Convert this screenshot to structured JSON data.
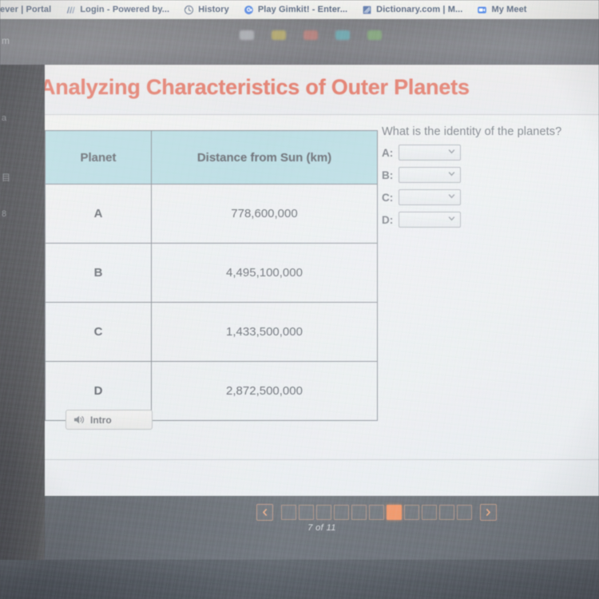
{
  "browser": {
    "bookmarks": [
      {
        "label": "ever | Portal",
        "icon": "generic-page-icon",
        "truncated": false
      },
      {
        "label": "Login - Powered by...",
        "icon": "powerschool-icon",
        "truncated": true
      },
      {
        "label": "History",
        "icon": "history-clock-icon",
        "truncated": false
      },
      {
        "label": "Play Gimkit! - Enter...",
        "icon": "gimkit-g-icon",
        "truncated": true
      },
      {
        "label": "Dictionary.com | M...",
        "icon": "dictionary-book-icon",
        "truncated": true
      },
      {
        "label": "My Meet",
        "icon": "google-meet-camera-icon",
        "truncated": true
      }
    ],
    "chrome_ghost_text": "m",
    "bezel_ghost_text": [
      "a",
      "目",
      "8"
    ]
  },
  "lesson": {
    "title": "Analyzing Characteristics of Outer Planets",
    "title_color": "#e2705e"
  },
  "table": {
    "headers": [
      "Planet",
      "Distance from Sun (km)"
    ],
    "header_bg": "#b4dae1",
    "rows": [
      {
        "planet": "A",
        "distance": "778,600,000"
      },
      {
        "planet": "B",
        "distance": "4,495,100,000"
      },
      {
        "planet": "C",
        "distance": "1,433,500,000"
      },
      {
        "planet": "D",
        "distance": "2,872,500,000"
      }
    ]
  },
  "question": {
    "prompt": "What is the identity of the planets?",
    "answers": [
      {
        "label": "A:",
        "value": "",
        "placeholder": ""
      },
      {
        "label": "B:",
        "value": "",
        "placeholder": ""
      },
      {
        "label": "C:",
        "value": "",
        "placeholder": ""
      },
      {
        "label": "D:",
        "value": "",
        "placeholder": ""
      }
    ]
  },
  "audio": {
    "intro_label": "Intro",
    "icon": "speaker-volume-icon"
  },
  "pagination": {
    "prev_icon": "chevron-left-icon",
    "next_icon": "chevron-right-icon",
    "total_pages": 11,
    "current_page": 7,
    "status": "7 of 11",
    "active_color": "#f08a55"
  }
}
